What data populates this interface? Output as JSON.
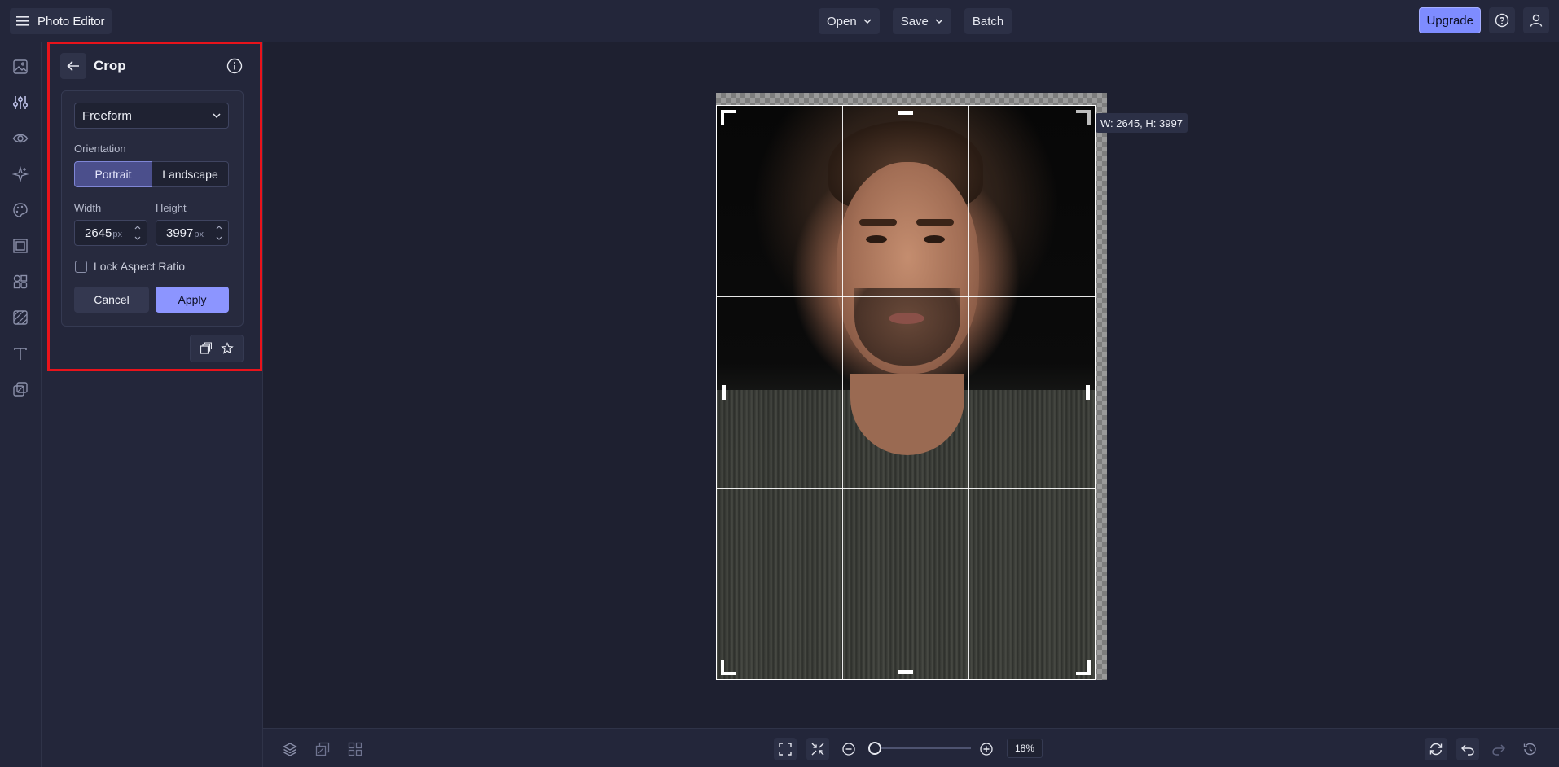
{
  "app": {
    "title": "Photo Editor"
  },
  "topbar": {
    "menu_icon": "hamburger-icon",
    "open_label": "Open",
    "save_label": "Save",
    "batch_label": "Batch",
    "upgrade_label": "Upgrade",
    "help_icon": "help-icon",
    "account_icon": "user-icon"
  },
  "rail": {
    "items": [
      {
        "name": "image",
        "icon": "image-icon"
      },
      {
        "name": "adjust",
        "icon": "sliders-icon",
        "active": true
      },
      {
        "name": "effects",
        "icon": "eye-icon"
      },
      {
        "name": "ai-tools",
        "icon": "sparkle-icon"
      },
      {
        "name": "retouch",
        "icon": "palette-icon"
      },
      {
        "name": "frames",
        "icon": "frame-icon"
      },
      {
        "name": "graphics",
        "icon": "shapes-icon"
      },
      {
        "name": "textures",
        "icon": "texture-icon"
      },
      {
        "name": "text",
        "icon": "text-icon"
      },
      {
        "name": "overlays",
        "icon": "overlay-icon"
      }
    ]
  },
  "crop_panel": {
    "title": "Crop",
    "preset": "Freeform",
    "orientation_label": "Orientation",
    "orientation_options": [
      "Portrait",
      "Landscape"
    ],
    "orientation_selected": "Portrait",
    "width_label": "Width",
    "height_label": "Height",
    "width_value": "2645",
    "height_value": "3997",
    "unit": "px",
    "lock_label": "Lock Aspect Ratio",
    "lock_checked": false,
    "cancel_label": "Cancel",
    "apply_label": "Apply"
  },
  "canvas": {
    "dims_tooltip": "W: 2645, H: 3997"
  },
  "bottombar": {
    "zoom_value": "18%",
    "zoom_fraction": 0.05
  },
  "colors": {
    "accent": "#8c95ff",
    "highlight_box": "#e8131b",
    "background": "#1f2130"
  }
}
